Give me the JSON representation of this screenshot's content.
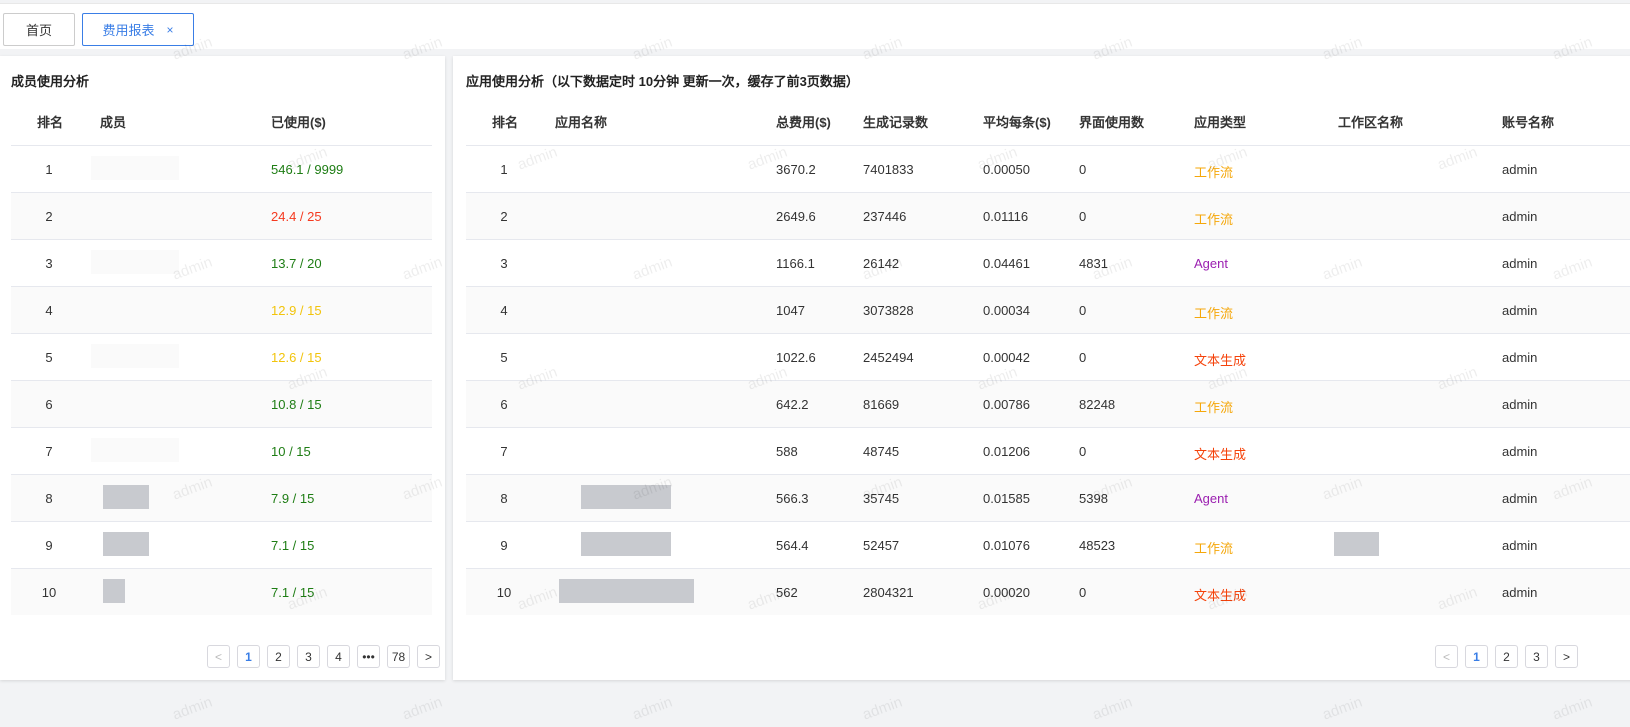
{
  "tabs": [
    {
      "label": "首页"
    },
    {
      "label": "费用报表",
      "close": "×"
    }
  ],
  "watermark": "admin",
  "members": {
    "title": "成员使用分析",
    "headers": [
      "排名",
      "成员",
      "已使用($)"
    ],
    "rows": [
      {
        "rank": "1",
        "used": "546.1 / 9999",
        "color": "#1e7d14"
      },
      {
        "rank": "2",
        "used": "24.4 / 25",
        "color": "#f5391f"
      },
      {
        "rank": "3",
        "used": "13.7 / 20",
        "color": "#1e7d14"
      },
      {
        "rank": "4",
        "used": "12.9 / 15",
        "color": "#f2c40c"
      },
      {
        "rank": "5",
        "used": "12.6 / 15",
        "color": "#f2c40c"
      },
      {
        "rank": "6",
        "used": "10.8 / 15",
        "color": "#1e7d14"
      },
      {
        "rank": "7",
        "used": "10 / 15",
        "color": "#1e7d14"
      },
      {
        "rank": "8",
        "used": "7.9 / 15",
        "color": "#1e7d14"
      },
      {
        "rank": "9",
        "used": "7.1 / 15",
        "color": "#1e7d14"
      },
      {
        "rank": "10",
        "used": "7.1 / 15",
        "color": "#1e7d14"
      }
    ],
    "pager": {
      "prev": "<",
      "pages": [
        "1",
        "2",
        "3",
        "4",
        "•••",
        "78"
      ],
      "next": ">",
      "current": "1"
    }
  },
  "apps": {
    "title": "应用使用分析（以下数据定时 10分钟 更新一次，缓存了前3页数据）",
    "headers": [
      "排名",
      "应用名称",
      "总费用($)",
      "生成记录数",
      "平均每条($)",
      "界面使用数",
      "应用类型",
      "工作区名称",
      "账号名称"
    ],
    "rows": [
      {
        "rank": "1",
        "cost": "3670.2",
        "records": "7401833",
        "avg": "0.00050",
        "ui": "0",
        "type": "工作流",
        "account": "admin"
      },
      {
        "rank": "2",
        "cost": "2649.6",
        "records": "237446",
        "avg": "0.01116",
        "ui": "0",
        "type": "工作流",
        "account": "admin"
      },
      {
        "rank": "3",
        "cost": "1166.1",
        "records": "26142",
        "avg": "0.04461",
        "ui": "4831",
        "type": "Agent",
        "account": "admin"
      },
      {
        "rank": "4",
        "cost": "1047",
        "records": "3073828",
        "avg": "0.00034",
        "ui": "0",
        "type": "工作流",
        "account": "admin"
      },
      {
        "rank": "5",
        "cost": "1022.6",
        "records": "2452494",
        "avg": "0.00042",
        "ui": "0",
        "type": "文本生成",
        "account": "admin"
      },
      {
        "rank": "6",
        "cost": "642.2",
        "records": "81669",
        "avg": "0.00786",
        "ui": "82248",
        "type": "工作流",
        "account": "admin"
      },
      {
        "rank": "7",
        "cost": "588",
        "records": "48745",
        "avg": "0.01206",
        "ui": "0",
        "type": "文本生成",
        "account": "admin"
      },
      {
        "rank": "8",
        "cost": "566.3",
        "records": "35745",
        "avg": "0.01585",
        "ui": "5398",
        "type": "Agent",
        "account": "admin"
      },
      {
        "rank": "9",
        "cost": "564.4",
        "records": "52457",
        "avg": "0.01076",
        "ui": "48523",
        "type": "工作流",
        "account": "admin"
      },
      {
        "rank": "10",
        "cost": "562",
        "records": "2804321",
        "avg": "0.00020",
        "ui": "0",
        "type": "文本生成",
        "account": "admin"
      }
    ],
    "type_colors": {
      "工作流": "#f5a70a",
      "Agent": "#9b1fb0",
      "文本生成": "#f5420a"
    },
    "pager": {
      "prev": "<",
      "pages": [
        "1",
        "2",
        "3"
      ],
      "next": ">",
      "current": "1"
    }
  }
}
